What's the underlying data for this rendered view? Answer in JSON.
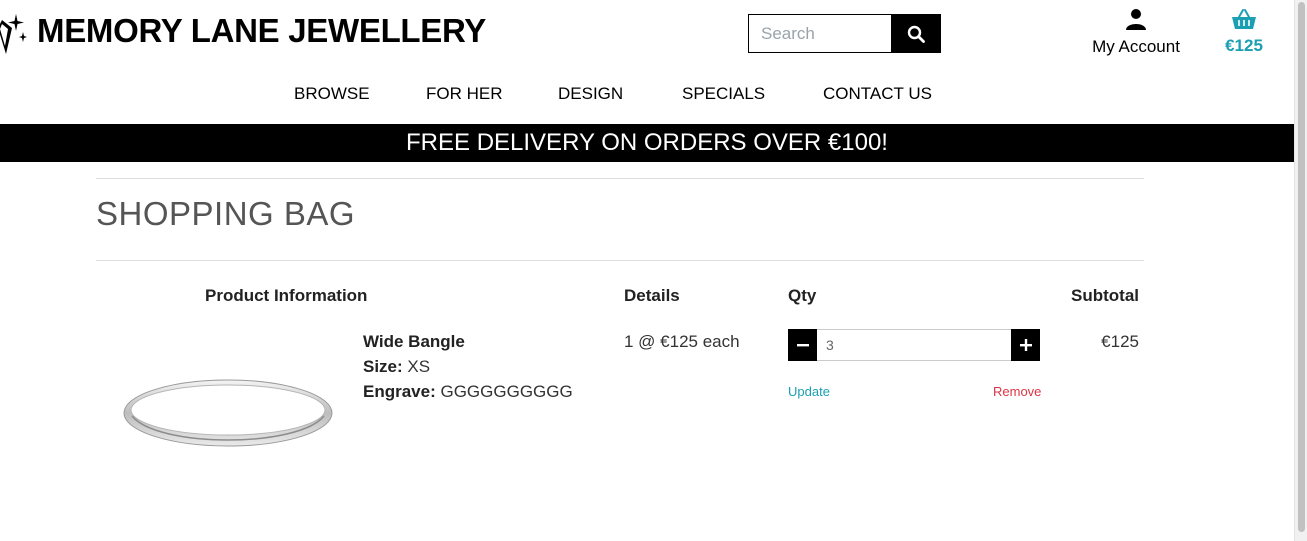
{
  "header": {
    "brand": "MEMORY LANE JEWELLERY",
    "search": {
      "placeholder": "Search",
      "value": ""
    },
    "account_label": "My Account",
    "cart_total": "€125"
  },
  "nav": {
    "items": [
      {
        "label": "BROWSE"
      },
      {
        "label": "FOR HER"
      },
      {
        "label": "DESIGN"
      },
      {
        "label": "SPECIALS"
      },
      {
        "label": "CONTACT US"
      }
    ]
  },
  "banner": {
    "text": "FREE DELIVERY ON ORDERS OVER €100!"
  },
  "bag": {
    "title": "SHOPPING BAG",
    "columns": {
      "product": "Product Information",
      "details": "Details",
      "qty": "Qty",
      "subtotal": "Subtotal"
    },
    "items": [
      {
        "name": "Wide Bangle",
        "size_label": "Size:",
        "size": "XS",
        "engrave_label": "Engrave:",
        "engrave": "GGGGGGGGGG",
        "details": "1 @ €125 each",
        "quantity": "3",
        "update_label": "Update",
        "remove_label": "Remove",
        "subtotal": "€125"
      }
    ]
  },
  "colors": {
    "accent": "#1b9fb3",
    "remove": "#dc3545",
    "banner_bg": "#000000"
  },
  "icons": {
    "logo": "diamond-sparkle-icon",
    "search": "search-icon",
    "account": "user-icon",
    "cart": "basket-icon",
    "decrement": "minus-icon",
    "increment": "plus-icon"
  }
}
